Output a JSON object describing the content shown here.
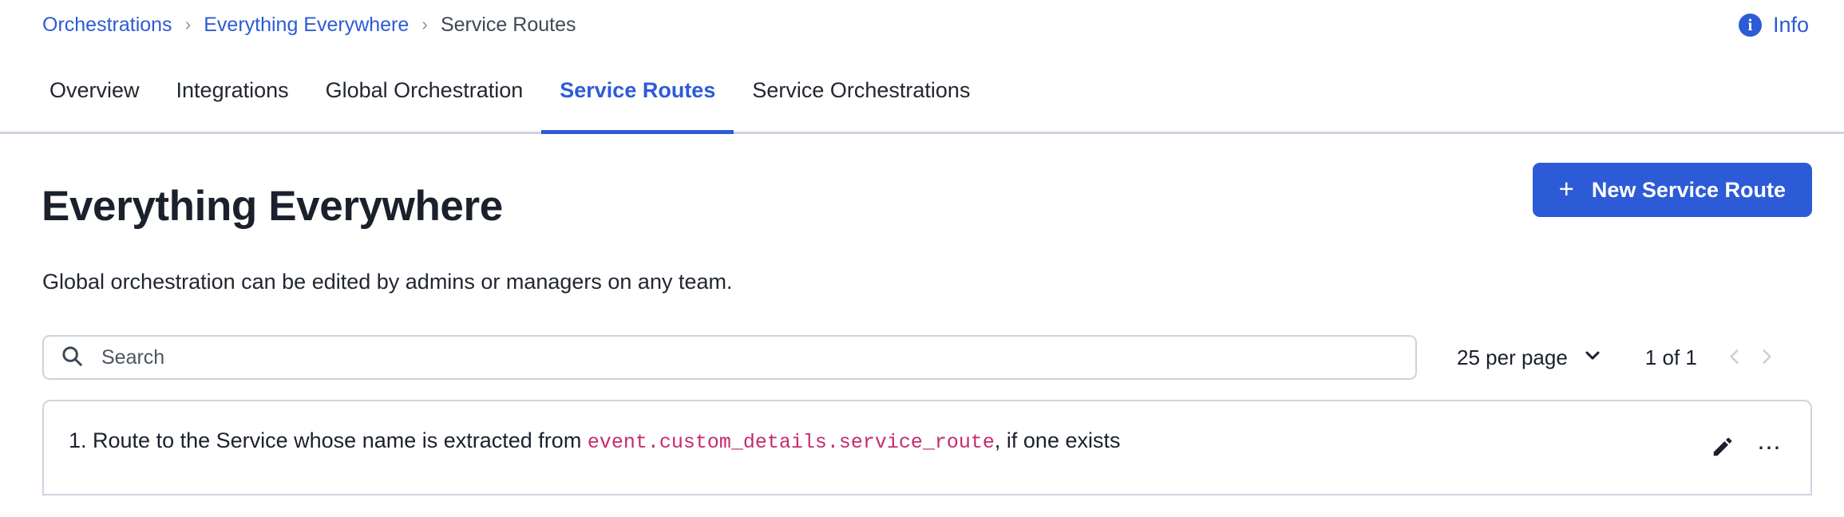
{
  "breadcrumb": {
    "items": [
      {
        "label": "Orchestrations",
        "is_link": true
      },
      {
        "label": "Everything Everywhere",
        "is_link": true
      },
      {
        "label": "Service Routes",
        "is_link": false
      }
    ],
    "separator": "›"
  },
  "header": {
    "info_label": "Info",
    "info_icon": "info-circle-icon",
    "info_color": "#2d5bd7"
  },
  "tabs": [
    {
      "label": "Overview",
      "active": false
    },
    {
      "label": "Integrations",
      "active": false
    },
    {
      "label": "Global Orchestration",
      "active": false
    },
    {
      "label": "Service Routes",
      "active": true
    },
    {
      "label": "Service Orchestrations",
      "active": false
    }
  ],
  "page": {
    "title": "Everything Everywhere",
    "subtitle": "Global orchestration can be edited by admins or managers on any team.",
    "new_button_label": "New Service Route",
    "new_button_icon": "plus-icon",
    "accent_color": "#2d5bd7"
  },
  "toolbar": {
    "search_placeholder": "Search",
    "search_value": "",
    "search_icon": "search-icon",
    "per_page_label": "25 per page",
    "per_page_icon": "chevron-down-icon",
    "page_count_label": "1 of 1",
    "prev_icon": "chevron-left-icon",
    "next_icon": "chevron-right-icon",
    "prev_disabled": true,
    "next_disabled": true
  },
  "routes": {
    "rows": [
      {
        "prefix": "1. Route to the Service whose name is extracted from ",
        "code": "event.custom_details.service_route",
        "suffix": ", if one exists",
        "edit_icon": "pencil-icon",
        "more_icon": "ellipsis-icon",
        "code_color": "#c72a6d"
      }
    ]
  }
}
